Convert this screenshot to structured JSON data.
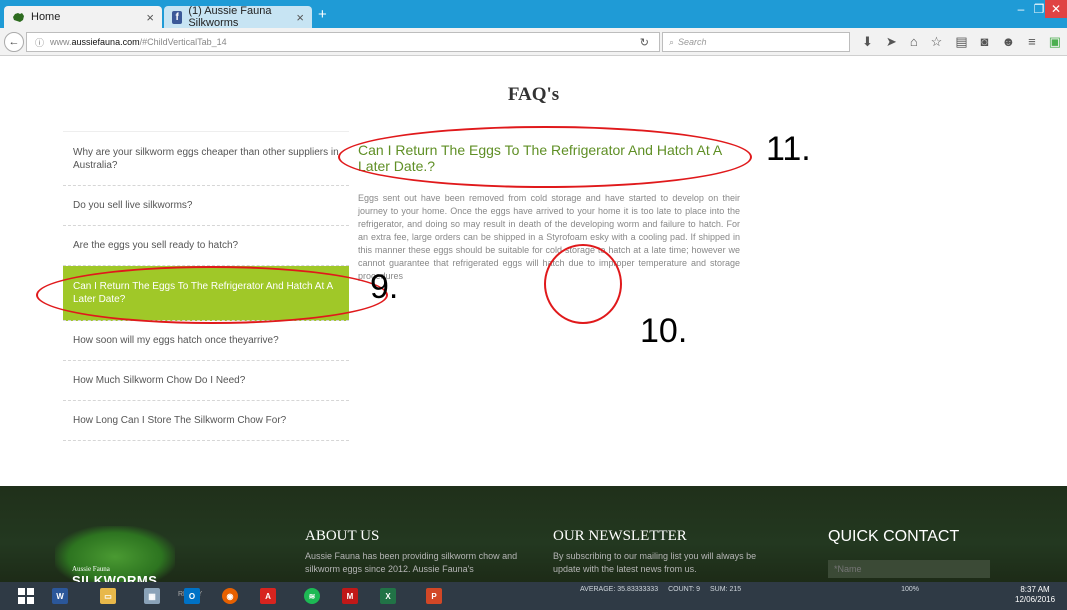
{
  "browser": {
    "tabs": [
      {
        "label": "Home",
        "icon": "aussie-map-icon"
      },
      {
        "label": "(1) Aussie Fauna Silkworms",
        "icon": "facebook-icon"
      }
    ],
    "url_prefix": "www.",
    "url_domain": "aussiefauna.com",
    "url_path": "/#ChildVerticalTab_14",
    "search_placeholder": "Search",
    "accent": "#1f9bd6"
  },
  "page": {
    "title": "FAQ's",
    "faq_items": [
      "Why are your silkworm eggs cheaper than other suppliers in Australia?",
      "Do you sell live silkworms?",
      "Are the eggs you sell ready to hatch?",
      "Can I Return The Eggs To The Refrigerator And Hatch At A Later Date?",
      "How soon will my eggs hatch once theyarrive?",
      "How Much Silkworm Chow Do I Need?",
      "How Long Can I Store The Silkworm Chow For?"
    ],
    "active_index": 3,
    "answer_title": "Can I Return The Eggs To The Refrigerator And Hatch At A Later Date.?",
    "answer_body": "Eggs sent out have been removed from cold storage and have started to develop on their journey to your home. Once the eggs have arrived to your home it is too late to place into the refrigerator, and doing so may result in death of the developing worm and failure to hatch. For an extra fee, large orders can be shipped in a Styrofoam esky with a cooling pad. If shipped in this manner these eggs should be suitable for cold storage to hatch at a late time; however we cannot guarantee that refrigerated eggs will hatch due to improper temperature and storage procedures",
    "active_color": "#a0c828",
    "title_color": "#5f8f25"
  },
  "annotations": {
    "n9": "9.",
    "n10": "10.",
    "n11": "11.",
    "color": "#e0191b"
  },
  "footer": {
    "about_title": "ABOUT US",
    "about_text": "Aussie Fauna has been providing silkworm chow and silkworm eggs since 2012. Aussie Fauna's",
    "newsletter_title": "OUR NEWSLETTER",
    "newsletter_text": "By subscribing to our mailing list you will always be update with the latest news from us.",
    "contact_title": "QUICK CONTACT",
    "name_placeholder": "*Name",
    "logo_small": "Aussie Fauna",
    "logo_big": "SILKWORMS"
  },
  "taskbar": {
    "ready": "READY",
    "average": "AVERAGE: 35.83333333",
    "count": "COUNT: 9",
    "sum": "SUM: 215",
    "zoom": "100%",
    "time": "8:37 AM",
    "date": "12/06/2016"
  }
}
